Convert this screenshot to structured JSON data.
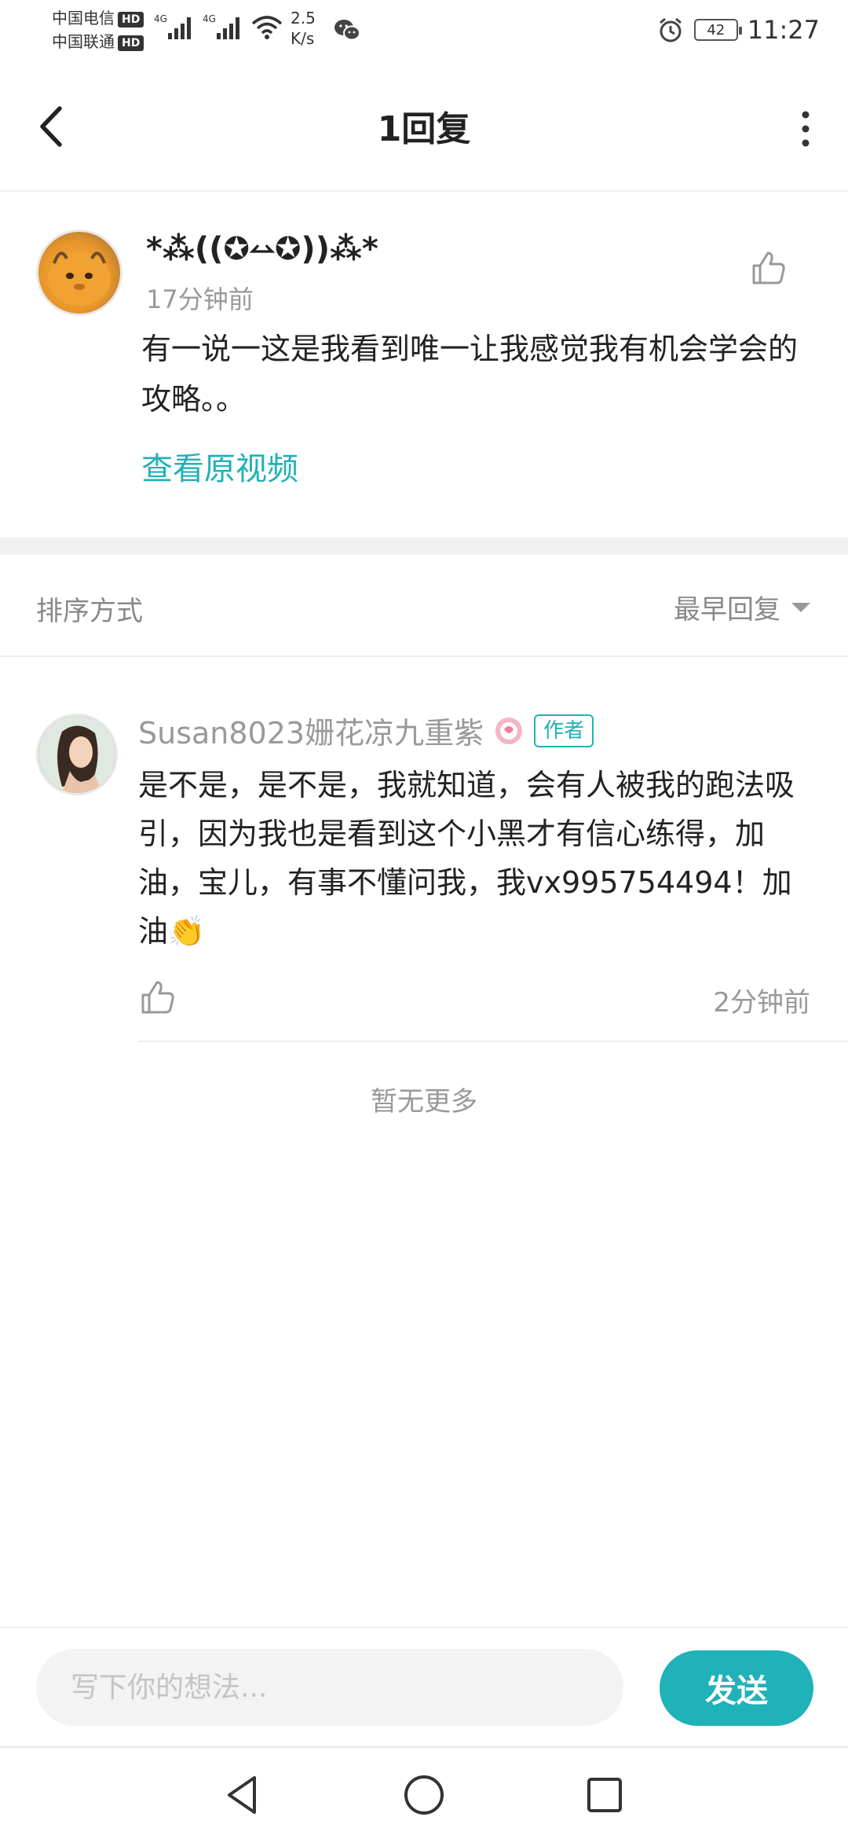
{
  "status_bar": {
    "carrier1": "中国电信",
    "carrier2": "中国联通",
    "hd": "HD",
    "network_type": "4G",
    "speed_value": "2.5",
    "speed_unit": "K/s",
    "battery": "42",
    "time": "11:27"
  },
  "header": {
    "title": "1回复"
  },
  "main_comment": {
    "username": "*⁂((✪⥎✪))⁂*",
    "time": "17分钟前",
    "text": "有一说一这是我看到唯一让我感觉我有机会学会的攻略。。",
    "link": "查看原视频"
  },
  "sort": {
    "label": "排序方式",
    "selected": "最早回复"
  },
  "reply": {
    "username": "Susan8023姗花凉九重紫",
    "author_badge": "作者",
    "text": "是不是，是不是，我就知道，会有人被我的跑法吸引，因为我也是看到这个小黑才有信心练得，加油，宝儿，有事不懂问我，我vx995754494！加油👏",
    "time": "2分钟前"
  },
  "footer_note": "暂无更多",
  "input_bar": {
    "placeholder": "写下你的想法...",
    "send_label": "发送"
  },
  "colors": {
    "accent": "#1fb2b8",
    "muted_text": "#999999",
    "divider": "#eeeeee"
  },
  "icons": [
    "back-arrow-icon",
    "more-vertical-icon",
    "thumbs-up-icon",
    "chevron-down-icon",
    "nav-back-icon",
    "nav-home-icon",
    "nav-recents-icon",
    "wifi-icon",
    "signal-icon",
    "alarm-icon",
    "wechat-icon"
  ]
}
